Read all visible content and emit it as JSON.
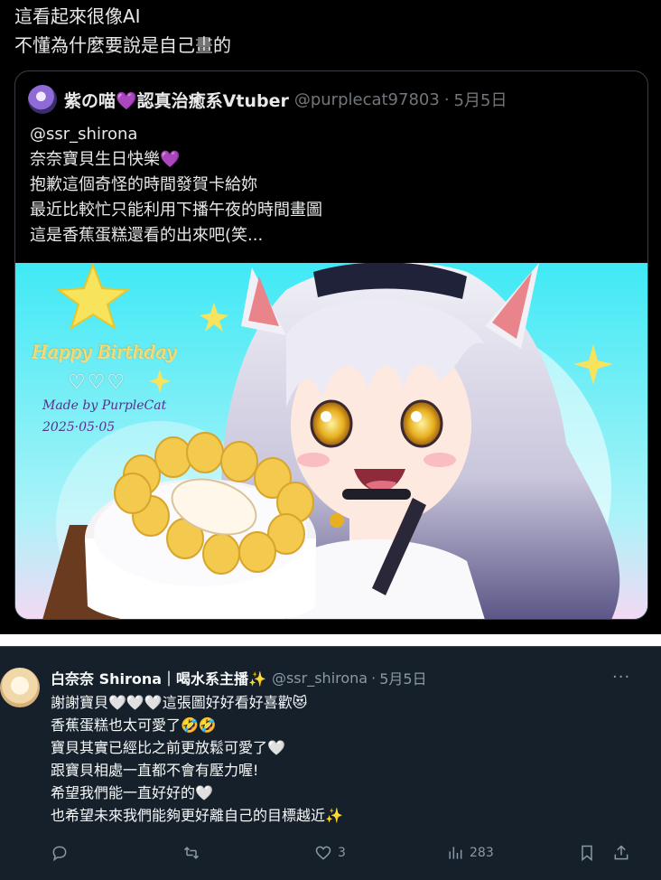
{
  "tweet": {
    "lines": [
      "這看起來很像AI",
      "不懂為什麼要說是自己畫的"
    ]
  },
  "quote": {
    "author_name": "紫の喵💜認真治癒系Vtuber",
    "handle": "@purplecat97803",
    "separator": "·",
    "date": "5月5日",
    "lines": [
      "@ssr_shirona",
      "奈奈寶貝生日快樂💜",
      "抱歉這個奇怪的時間發賀卡給妳",
      "最近比較忙只能利用下播午夜的時間畫圖",
      "這是香蕉蛋糕還看的出來吧(笑..."
    ],
    "image": {
      "title": "Happy Birthday",
      "hearts": "♡♡♡",
      "credit": "Made by PurpleCat",
      "date": "2025·05·05",
      "background_color": "#49e6f2"
    }
  },
  "reply": {
    "author_name": "白奈奈 Shirona｜喝水系主播✨",
    "handle": "@ssr_shirona",
    "separator": "·",
    "date": "5月5日",
    "more": "···",
    "lines": [
      "謝謝寶貝🤍🤍🤍這張圖好好看好喜歡😻",
      "香蕉蛋糕也太可愛了🤣🤣",
      "寶貝其實已經比之前更放鬆可愛了🤍",
      "跟寶貝相處一直都不會有壓力喔!",
      "希望我們能一直好好的🤍",
      "也希望未來我們能夠更好離自己的目標越近✨"
    ],
    "actions": {
      "reply_count": "",
      "retweet_count": "",
      "like_count": "3",
      "view_count": "283"
    },
    "icons": [
      "reply-icon",
      "retweet-icon",
      "like-icon",
      "views-icon",
      "bookmark-icon",
      "share-icon"
    ]
  }
}
